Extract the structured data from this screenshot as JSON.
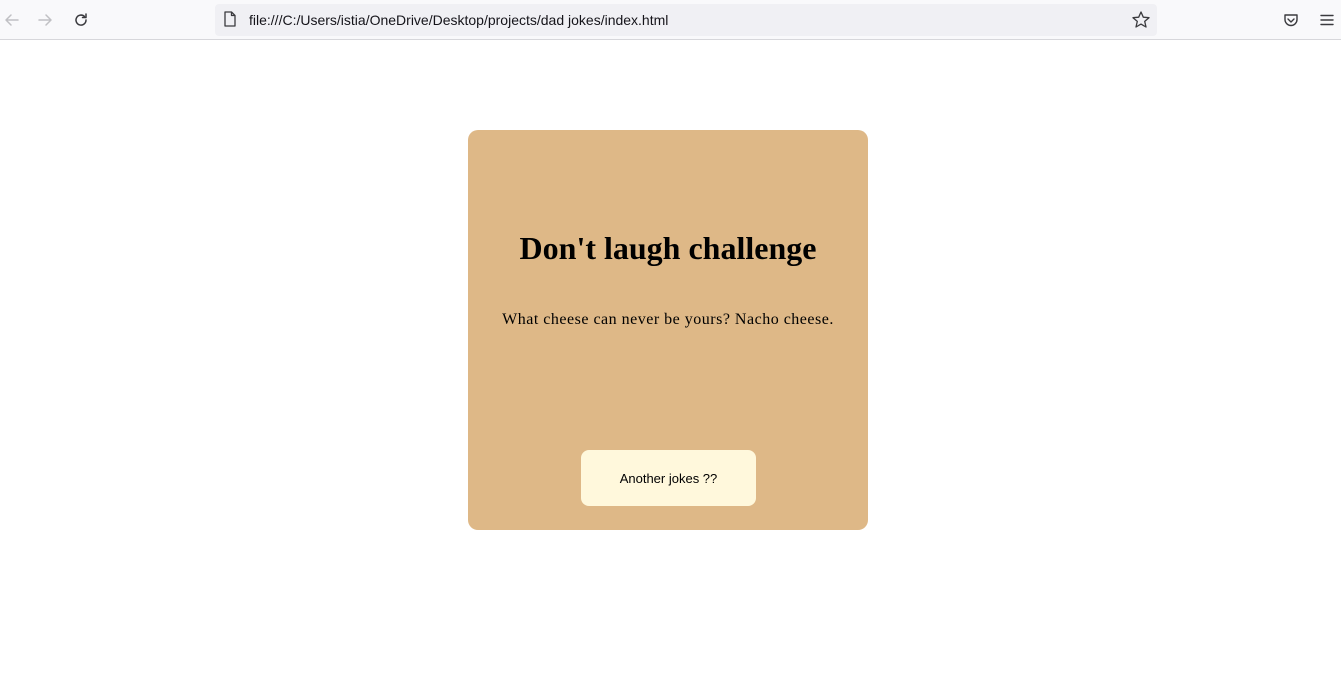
{
  "browser": {
    "url": "file:///C:/Users/istia/OneDrive/Desktop/projects/dad jokes/index.html",
    "icons": {
      "back": "arrow-left-icon",
      "forward": "arrow-right-icon",
      "reload": "reload-icon",
      "page": "page-icon",
      "bookmark": "star-icon",
      "pocket": "pocket-icon",
      "menu": "hamburger-menu-icon"
    }
  },
  "card": {
    "title": "Don't laugh challenge",
    "joke": "What cheese can never be yours? Nacho cheese.",
    "button_label": "Another jokes ??"
  },
  "colors": {
    "card_background": "#deb887",
    "button_background": "#fff8dc"
  }
}
